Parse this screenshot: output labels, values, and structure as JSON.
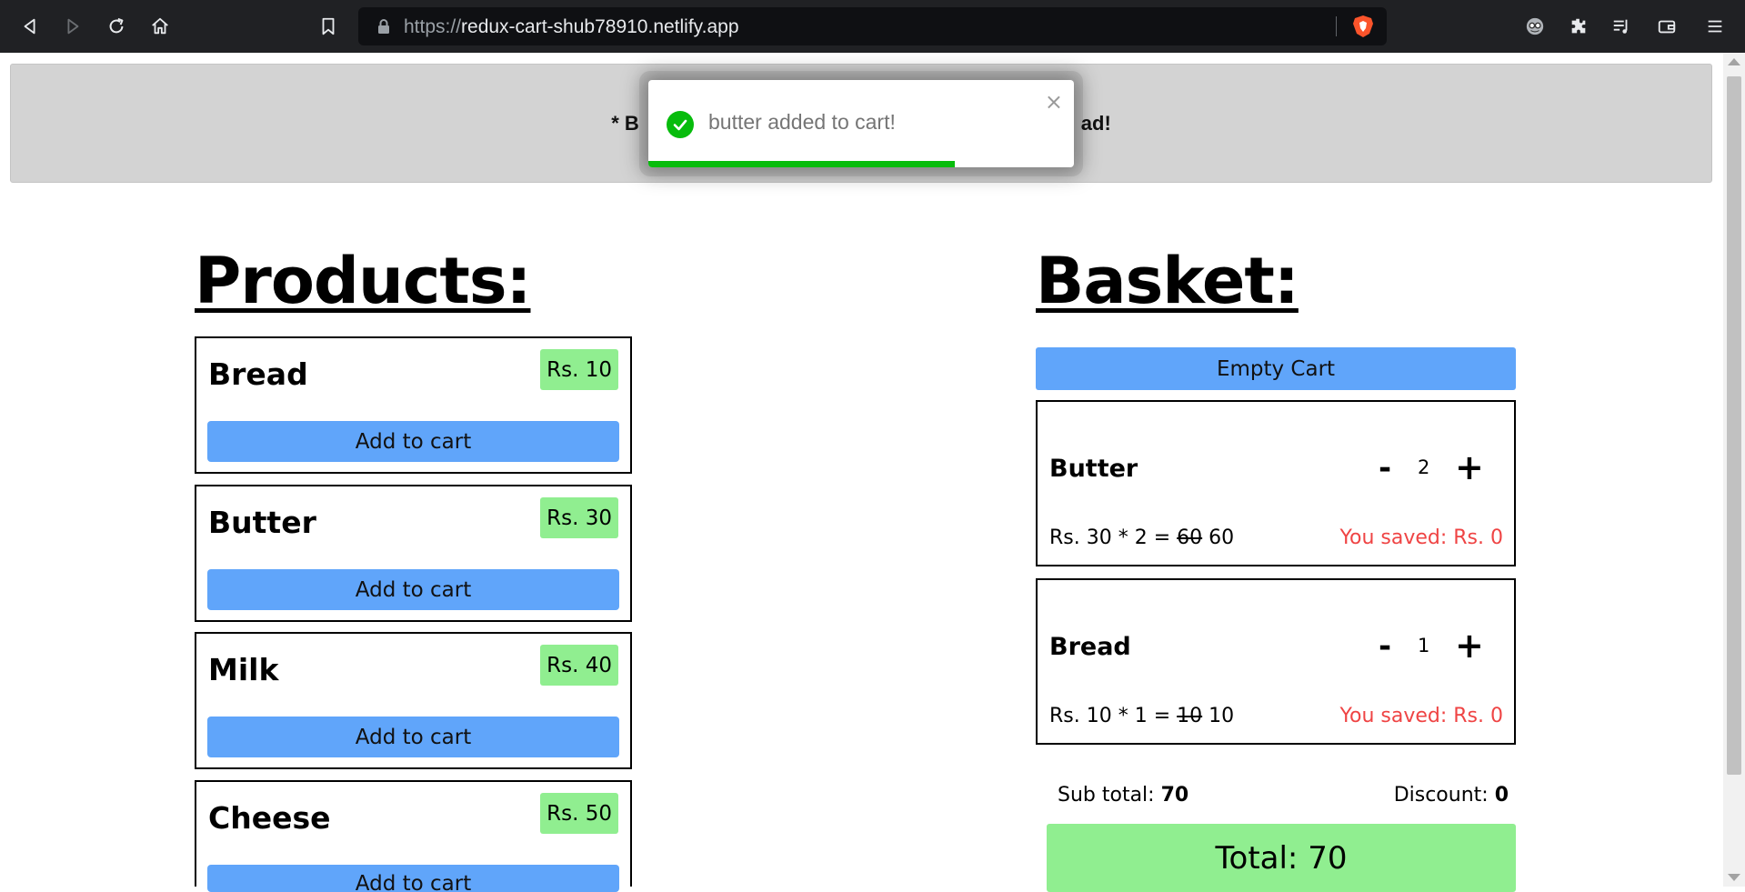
{
  "browser": {
    "url_scheme": "https://",
    "url_host": "redux-cart-shub78910.netlify.app",
    "icons": [
      "back-icon",
      "forward-icon",
      "reload-icon",
      "home-icon",
      "bookmark-icon",
      "lock-icon",
      "brave-shield-icon",
      "profile-icon",
      "extensions-icon",
      "playlist-icon",
      "wallet-icon",
      "menu-icon"
    ]
  },
  "banner": {
    "text_start": "* B",
    "text_end": "ad!"
  },
  "toast": {
    "message": "butter added to cart!",
    "close": "×",
    "progress": 0.72,
    "color": "#07bc0c"
  },
  "products": {
    "title": "Products:",
    "add_label": "Add to cart",
    "items": [
      {
        "name": "Bread",
        "price": "Rs. 10"
      },
      {
        "name": "Butter",
        "price": "Rs. 30"
      },
      {
        "name": "Milk",
        "price": "Rs. 40"
      },
      {
        "name": "Cheese",
        "price": "Rs. 50"
      }
    ]
  },
  "basket": {
    "title": "Basket:",
    "empty_label": "Empty Cart",
    "items": [
      {
        "name": "Butter",
        "minus": "-",
        "qty": "2",
        "plus": "+",
        "calc": "Rs. 30 * 2 = ",
        "old_price": "60",
        "new_price": " 60",
        "saved": "You saved: Rs. 0"
      },
      {
        "name": "Bread",
        "minus": "-",
        "qty": "1",
        "plus": "+",
        "calc": "Rs. 10 * 1 = ",
        "old_price": "10",
        "new_price": " 10",
        "saved": "You saved: Rs. 0"
      }
    ],
    "subtotal_label": "Sub total: ",
    "subtotal_value": "70",
    "discount_label": "Discount: ",
    "discount_value": "0",
    "total": "Total: 70"
  },
  "colors": {
    "button_blue": "#60a5fa",
    "price_green": "#90ee90",
    "saved_red": "#ef4444",
    "banner_grey": "#d3d3d3"
  }
}
